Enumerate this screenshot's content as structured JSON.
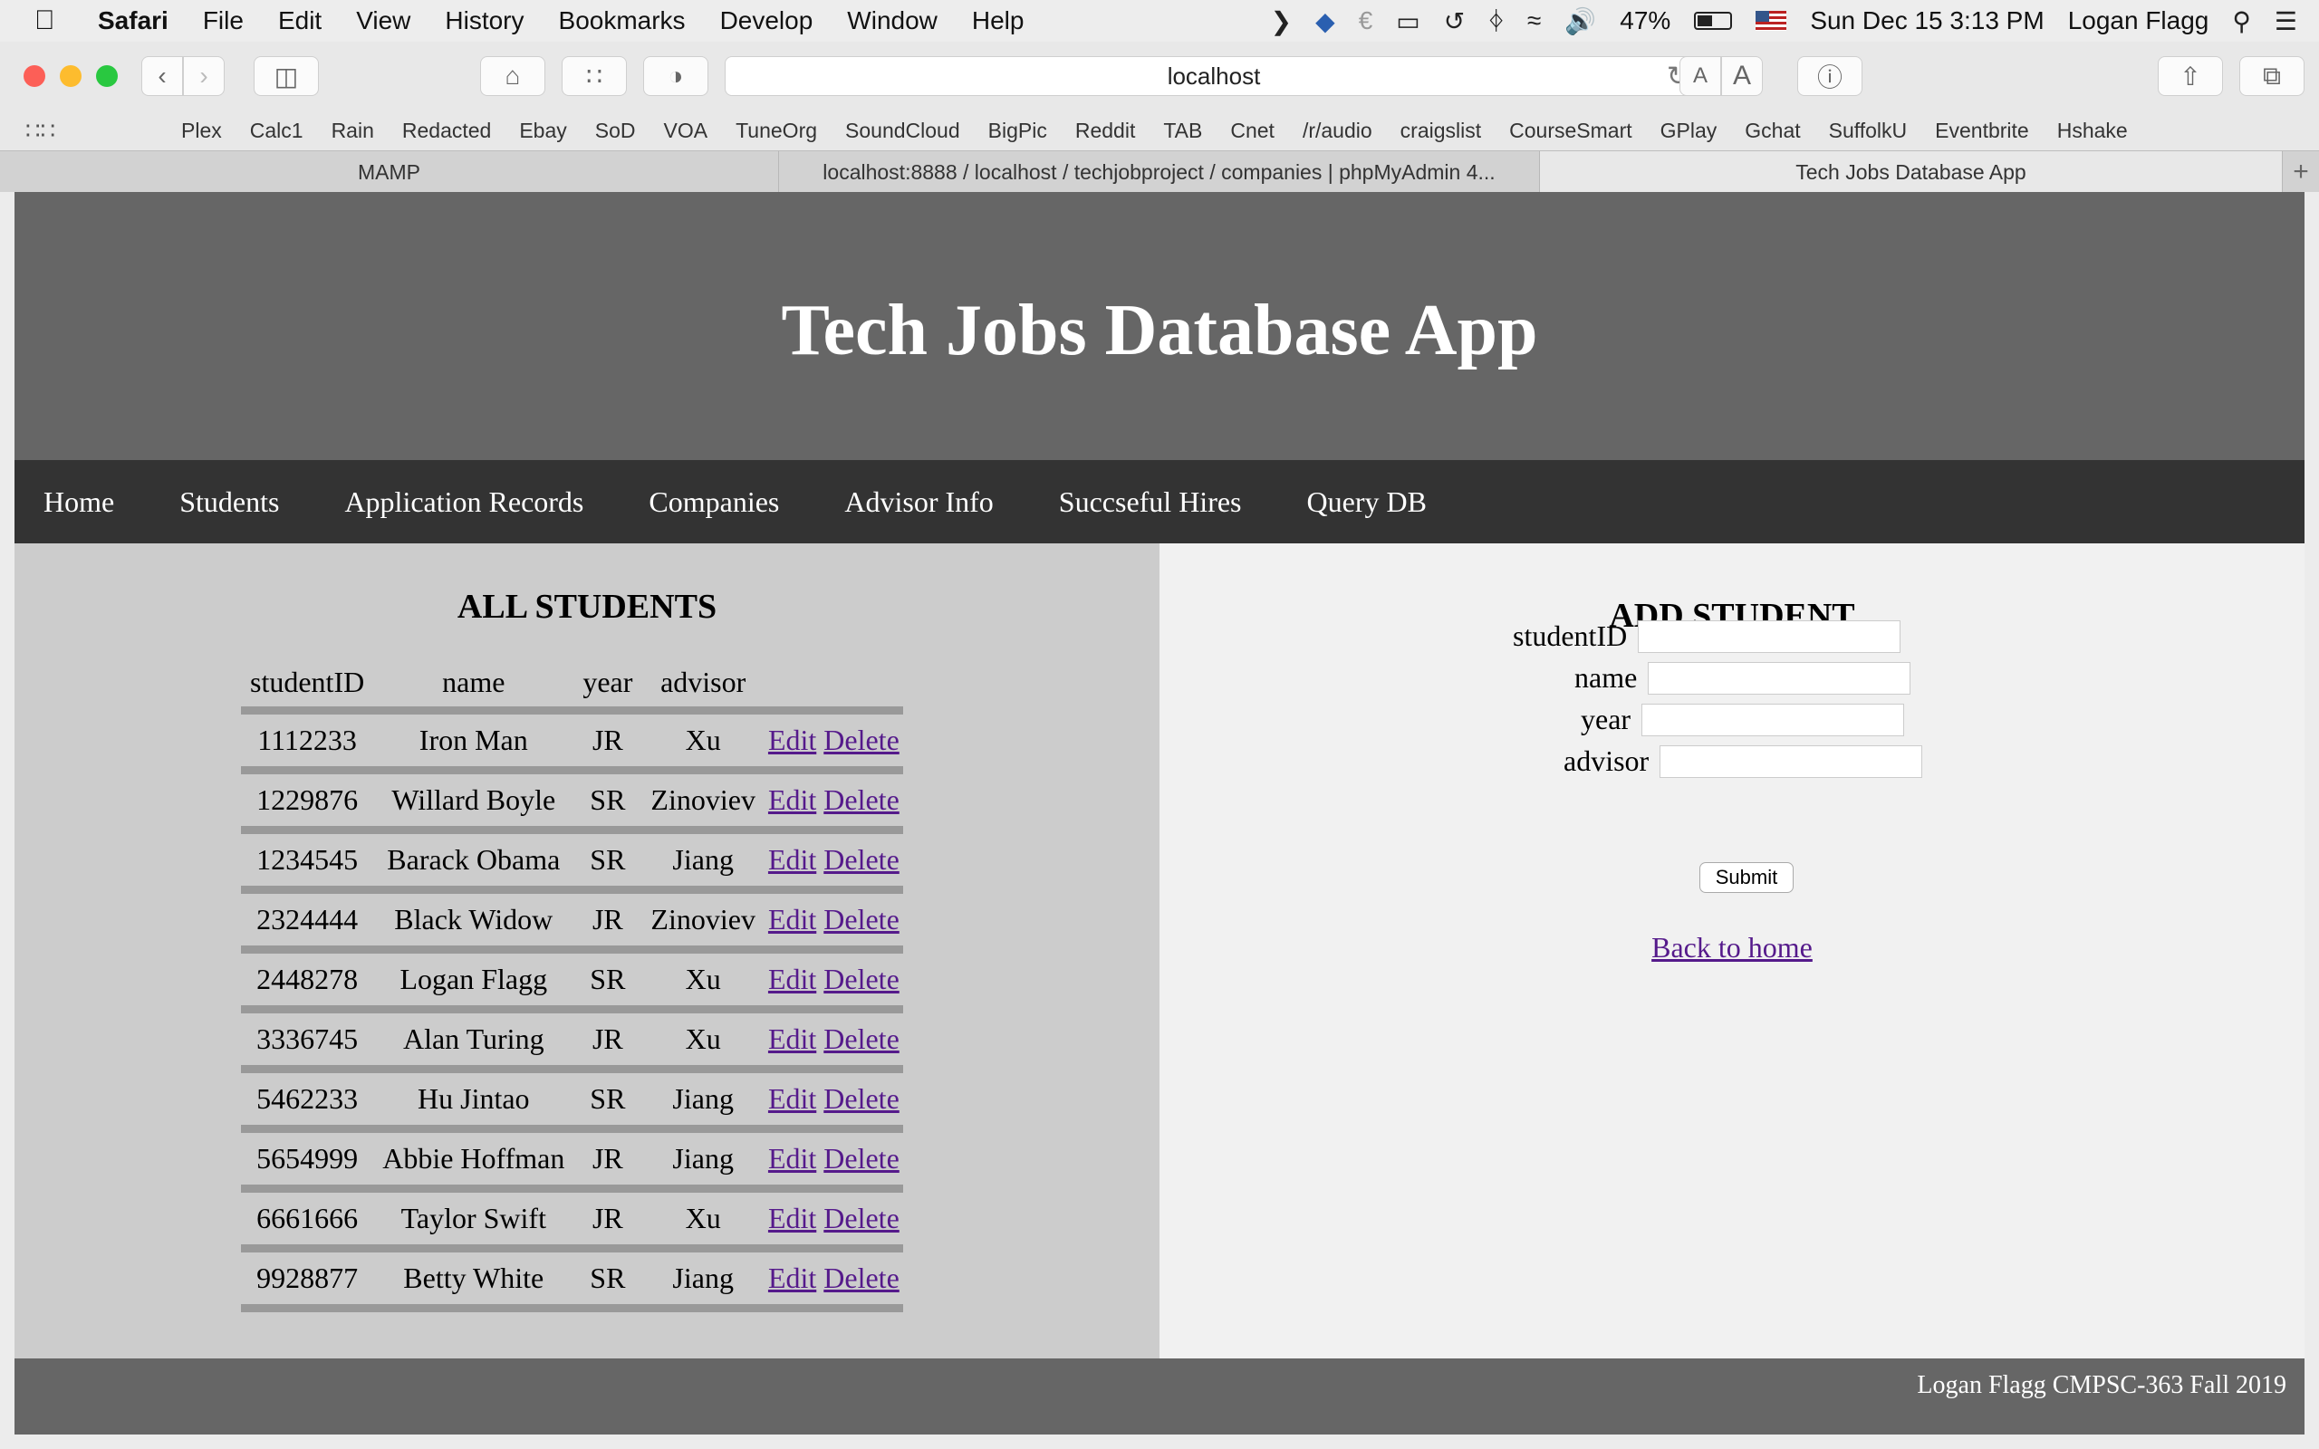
{
  "menubar": {
    "apple": "",
    "app_name": "Safari",
    "menus": [
      "File",
      "Edit",
      "View",
      "History",
      "Bookmarks",
      "Develop",
      "Window",
      "Help"
    ],
    "battery": "47%",
    "clock": "Sun Dec 15  3:13 PM",
    "user": "Logan Flagg"
  },
  "toolbar": {
    "url": "localhost"
  },
  "bookmarks": [
    "Plex",
    "Calc1",
    "Rain",
    "Redacted",
    "Ebay",
    "SoD",
    "VOA",
    "TuneOrg",
    "SoundCloud",
    "BigPic",
    "Reddit",
    "TAB",
    "Cnet",
    "/r/audio",
    "craigslist",
    "CourseSmart",
    "GPlay",
    "Gchat",
    "SuffolkU",
    "Eventbrite",
    "Hshake"
  ],
  "tabs": [
    {
      "label": "MAMP",
      "active": false
    },
    {
      "label": "localhost:8888 / localhost / techjobproject / companies | phpMyAdmin 4...",
      "active": false
    },
    {
      "label": "Tech Jobs Database App",
      "active": true
    }
  ],
  "page": {
    "title": "Tech Jobs Database App",
    "nav": [
      "Home",
      "Students",
      "Application Records",
      "Companies",
      "Advisor Info",
      "Succseful Hires",
      "Query DB"
    ],
    "students": {
      "heading": "ALL STUDENTS",
      "columns": [
        "studentID",
        "name",
        "year",
        "advisor"
      ],
      "edit_label": "Edit",
      "delete_label": "Delete",
      "rows": [
        [
          "1112233",
          "Iron Man",
          "JR",
          "Xu"
        ],
        [
          "1229876",
          "Willard Boyle",
          "SR",
          "Zinoviev"
        ],
        [
          "1234545",
          "Barack Obama",
          "SR",
          "Jiang"
        ],
        [
          "2324444",
          "Black Widow",
          "JR",
          "Zinoviev"
        ],
        [
          "2448278",
          "Logan Flagg",
          "SR",
          "Xu"
        ],
        [
          "3336745",
          "Alan Turing",
          "JR",
          "Xu"
        ],
        [
          "5462233",
          "Hu Jintao",
          "SR",
          "Jiang"
        ],
        [
          "5654999",
          "Abbie Hoffman",
          "JR",
          "Jiang"
        ],
        [
          "6661666",
          "Taylor Swift",
          "JR",
          "Xu"
        ],
        [
          "9928877",
          "Betty White",
          "SR",
          "Jiang"
        ]
      ]
    },
    "add_student": {
      "heading": "ADD STUDENT",
      "fields": [
        {
          "label": "studentID",
          "value": ""
        },
        {
          "label": "name",
          "value": ""
        },
        {
          "label": "year",
          "value": ""
        },
        {
          "label": "advisor",
          "value": ""
        }
      ],
      "submit_label": "Submit",
      "back_label": "Back to home"
    },
    "footer": "Logan Flagg CMPSC-363 Fall 2019"
  }
}
